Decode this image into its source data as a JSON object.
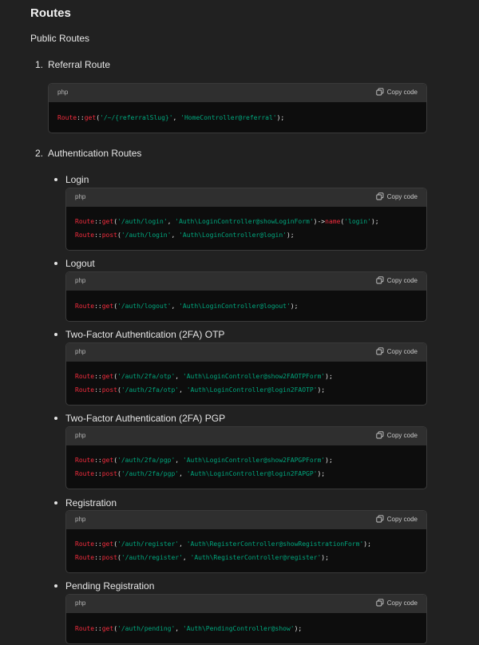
{
  "heading": "Routes",
  "subheading": "Public Routes",
  "copy_label": "Copy code",
  "colors": {
    "background": "#212121",
    "code_bg": "#0d0d0d",
    "code_header_bg": "#2f2f2f",
    "class_token": "#f22c3d",
    "string_token": "#00a67d"
  },
  "ordered": [
    {
      "num": "1.",
      "label": "Referral Route"
    },
    {
      "num": "2.",
      "label": "Authentication Routes"
    }
  ],
  "bullets": [
    "Login",
    "Logout",
    "Two-Factor Authentication (2FA) OTP",
    "Two-Factor Authentication (2FA) PGP",
    "Registration",
    "Pending Registration"
  ],
  "blocks": [
    {
      "lang": "php",
      "lines": [
        [
          [
            "c",
            "Route"
          ],
          [
            "p",
            "::"
          ],
          [
            "c",
            "get"
          ],
          [
            "p",
            "("
          ],
          [
            "s",
            "'/~/{referralSlug}'"
          ],
          [
            "p",
            ", "
          ],
          [
            "s",
            "'HomeController@referral'"
          ],
          [
            "p",
            ");"
          ]
        ]
      ]
    },
    {
      "lang": "php",
      "lines": [
        [
          [
            "c",
            "Route"
          ],
          [
            "p",
            "::"
          ],
          [
            "c",
            "get"
          ],
          [
            "p",
            "("
          ],
          [
            "s",
            "'/auth/login'"
          ],
          [
            "p",
            ", "
          ],
          [
            "s",
            "'Auth\\LoginController@showLoginForm'"
          ],
          [
            "p",
            ")->"
          ],
          [
            "c",
            "name"
          ],
          [
            "p",
            "("
          ],
          [
            "s",
            "'login'"
          ],
          [
            "p",
            ");"
          ]
        ],
        [
          [
            "c",
            "Route"
          ],
          [
            "p",
            "::"
          ],
          [
            "c",
            "post"
          ],
          [
            "p",
            "("
          ],
          [
            "s",
            "'/auth/login'"
          ],
          [
            "p",
            ", "
          ],
          [
            "s",
            "'Auth\\LoginController@login'"
          ],
          [
            "p",
            ");"
          ]
        ]
      ]
    },
    {
      "lang": "php",
      "lines": [
        [
          [
            "c",
            "Route"
          ],
          [
            "p",
            "::"
          ],
          [
            "c",
            "get"
          ],
          [
            "p",
            "("
          ],
          [
            "s",
            "'/auth/logout'"
          ],
          [
            "p",
            ", "
          ],
          [
            "s",
            "'Auth\\LoginController@logout'"
          ],
          [
            "p",
            ");"
          ]
        ]
      ]
    },
    {
      "lang": "php",
      "lines": [
        [
          [
            "c",
            "Route"
          ],
          [
            "p",
            "::"
          ],
          [
            "c",
            "get"
          ],
          [
            "p",
            "("
          ],
          [
            "s",
            "'/auth/2fa/otp'"
          ],
          [
            "p",
            ", "
          ],
          [
            "s",
            "'Auth\\LoginController@show2FAOTPForm'"
          ],
          [
            "p",
            ");"
          ]
        ],
        [
          [
            "c",
            "Route"
          ],
          [
            "p",
            "::"
          ],
          [
            "c",
            "post"
          ],
          [
            "p",
            "("
          ],
          [
            "s",
            "'/auth/2fa/otp'"
          ],
          [
            "p",
            ", "
          ],
          [
            "s",
            "'Auth\\LoginController@login2FAOTP'"
          ],
          [
            "p",
            ");"
          ]
        ]
      ]
    },
    {
      "lang": "php",
      "lines": [
        [
          [
            "c",
            "Route"
          ],
          [
            "p",
            "::"
          ],
          [
            "c",
            "get"
          ],
          [
            "p",
            "("
          ],
          [
            "s",
            "'/auth/2fa/pgp'"
          ],
          [
            "p",
            ", "
          ],
          [
            "s",
            "'Auth\\LoginController@show2FAPGPForm'"
          ],
          [
            "p",
            ");"
          ]
        ],
        [
          [
            "c",
            "Route"
          ],
          [
            "p",
            "::"
          ],
          [
            "c",
            "post"
          ],
          [
            "p",
            "("
          ],
          [
            "s",
            "'/auth/2fa/pgp'"
          ],
          [
            "p",
            ", "
          ],
          [
            "s",
            "'Auth\\LoginController@login2FAPGP'"
          ],
          [
            "p",
            ");"
          ]
        ]
      ]
    },
    {
      "lang": "php",
      "lines": [
        [
          [
            "c",
            "Route"
          ],
          [
            "p",
            "::"
          ],
          [
            "c",
            "get"
          ],
          [
            "p",
            "("
          ],
          [
            "s",
            "'/auth/register'"
          ],
          [
            "p",
            ", "
          ],
          [
            "s",
            "'Auth\\RegisterController@showRegistrationForm'"
          ],
          [
            "p",
            ");"
          ]
        ],
        [
          [
            "c",
            "Route"
          ],
          [
            "p",
            "::"
          ],
          [
            "c",
            "post"
          ],
          [
            "p",
            "("
          ],
          [
            "s",
            "'/auth/register'"
          ],
          [
            "p",
            ", "
          ],
          [
            "s",
            "'Auth\\RegisterController@register'"
          ],
          [
            "p",
            ");"
          ]
        ]
      ]
    },
    {
      "lang": "php",
      "lines": [
        [
          [
            "c",
            "Route"
          ],
          [
            "p",
            "::"
          ],
          [
            "c",
            "get"
          ],
          [
            "p",
            "("
          ],
          [
            "s",
            "'/auth/pending'"
          ],
          [
            "p",
            ", "
          ],
          [
            "s",
            "'Auth\\PendingController@show'"
          ],
          [
            "p",
            ");"
          ]
        ]
      ]
    }
  ]
}
